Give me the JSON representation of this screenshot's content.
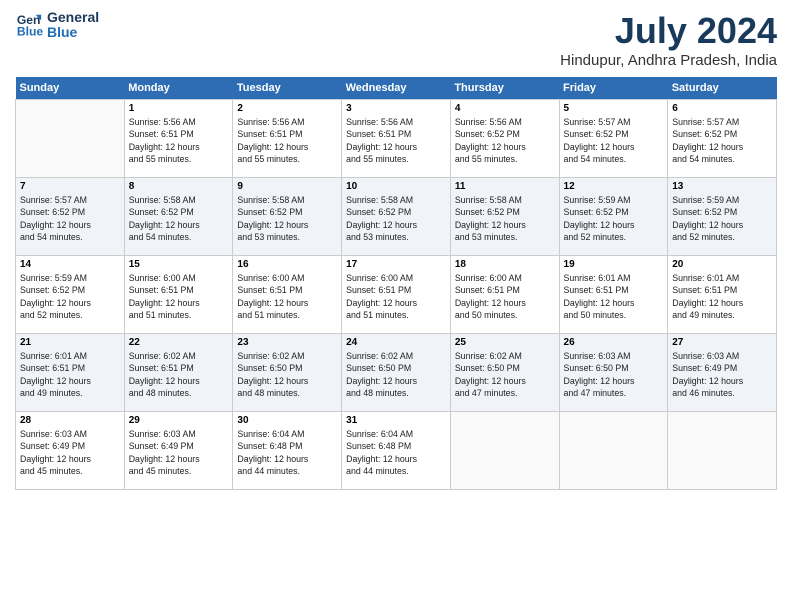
{
  "header": {
    "logo_line1": "General",
    "logo_line2": "Blue",
    "title": "July 2024",
    "subtitle": "Hindupur, Andhra Pradesh, India"
  },
  "calendar": {
    "days_of_week": [
      "Sunday",
      "Monday",
      "Tuesday",
      "Wednesday",
      "Thursday",
      "Friday",
      "Saturday"
    ],
    "weeks": [
      [
        {
          "num": "",
          "info": ""
        },
        {
          "num": "1",
          "info": "Sunrise: 5:56 AM\nSunset: 6:51 PM\nDaylight: 12 hours\nand 55 minutes."
        },
        {
          "num": "2",
          "info": "Sunrise: 5:56 AM\nSunset: 6:51 PM\nDaylight: 12 hours\nand 55 minutes."
        },
        {
          "num": "3",
          "info": "Sunrise: 5:56 AM\nSunset: 6:51 PM\nDaylight: 12 hours\nand 55 minutes."
        },
        {
          "num": "4",
          "info": "Sunrise: 5:56 AM\nSunset: 6:52 PM\nDaylight: 12 hours\nand 55 minutes."
        },
        {
          "num": "5",
          "info": "Sunrise: 5:57 AM\nSunset: 6:52 PM\nDaylight: 12 hours\nand 54 minutes."
        },
        {
          "num": "6",
          "info": "Sunrise: 5:57 AM\nSunset: 6:52 PM\nDaylight: 12 hours\nand 54 minutes."
        }
      ],
      [
        {
          "num": "7",
          "info": "Sunrise: 5:57 AM\nSunset: 6:52 PM\nDaylight: 12 hours\nand 54 minutes."
        },
        {
          "num": "8",
          "info": "Sunrise: 5:58 AM\nSunset: 6:52 PM\nDaylight: 12 hours\nand 54 minutes."
        },
        {
          "num": "9",
          "info": "Sunrise: 5:58 AM\nSunset: 6:52 PM\nDaylight: 12 hours\nand 53 minutes."
        },
        {
          "num": "10",
          "info": "Sunrise: 5:58 AM\nSunset: 6:52 PM\nDaylight: 12 hours\nand 53 minutes."
        },
        {
          "num": "11",
          "info": "Sunrise: 5:58 AM\nSunset: 6:52 PM\nDaylight: 12 hours\nand 53 minutes."
        },
        {
          "num": "12",
          "info": "Sunrise: 5:59 AM\nSunset: 6:52 PM\nDaylight: 12 hours\nand 52 minutes."
        },
        {
          "num": "13",
          "info": "Sunrise: 5:59 AM\nSunset: 6:52 PM\nDaylight: 12 hours\nand 52 minutes."
        }
      ],
      [
        {
          "num": "14",
          "info": "Sunrise: 5:59 AM\nSunset: 6:52 PM\nDaylight: 12 hours\nand 52 minutes."
        },
        {
          "num": "15",
          "info": "Sunrise: 6:00 AM\nSunset: 6:51 PM\nDaylight: 12 hours\nand 51 minutes."
        },
        {
          "num": "16",
          "info": "Sunrise: 6:00 AM\nSunset: 6:51 PM\nDaylight: 12 hours\nand 51 minutes."
        },
        {
          "num": "17",
          "info": "Sunrise: 6:00 AM\nSunset: 6:51 PM\nDaylight: 12 hours\nand 51 minutes."
        },
        {
          "num": "18",
          "info": "Sunrise: 6:00 AM\nSunset: 6:51 PM\nDaylight: 12 hours\nand 50 minutes."
        },
        {
          "num": "19",
          "info": "Sunrise: 6:01 AM\nSunset: 6:51 PM\nDaylight: 12 hours\nand 50 minutes."
        },
        {
          "num": "20",
          "info": "Sunrise: 6:01 AM\nSunset: 6:51 PM\nDaylight: 12 hours\nand 49 minutes."
        }
      ],
      [
        {
          "num": "21",
          "info": "Sunrise: 6:01 AM\nSunset: 6:51 PM\nDaylight: 12 hours\nand 49 minutes."
        },
        {
          "num": "22",
          "info": "Sunrise: 6:02 AM\nSunset: 6:51 PM\nDaylight: 12 hours\nand 48 minutes."
        },
        {
          "num": "23",
          "info": "Sunrise: 6:02 AM\nSunset: 6:50 PM\nDaylight: 12 hours\nand 48 minutes."
        },
        {
          "num": "24",
          "info": "Sunrise: 6:02 AM\nSunset: 6:50 PM\nDaylight: 12 hours\nand 48 minutes."
        },
        {
          "num": "25",
          "info": "Sunrise: 6:02 AM\nSunset: 6:50 PM\nDaylight: 12 hours\nand 47 minutes."
        },
        {
          "num": "26",
          "info": "Sunrise: 6:03 AM\nSunset: 6:50 PM\nDaylight: 12 hours\nand 47 minutes."
        },
        {
          "num": "27",
          "info": "Sunrise: 6:03 AM\nSunset: 6:49 PM\nDaylight: 12 hours\nand 46 minutes."
        }
      ],
      [
        {
          "num": "28",
          "info": "Sunrise: 6:03 AM\nSunset: 6:49 PM\nDaylight: 12 hours\nand 45 minutes."
        },
        {
          "num": "29",
          "info": "Sunrise: 6:03 AM\nSunset: 6:49 PM\nDaylight: 12 hours\nand 45 minutes."
        },
        {
          "num": "30",
          "info": "Sunrise: 6:04 AM\nSunset: 6:48 PM\nDaylight: 12 hours\nand 44 minutes."
        },
        {
          "num": "31",
          "info": "Sunrise: 6:04 AM\nSunset: 6:48 PM\nDaylight: 12 hours\nand 44 minutes."
        },
        {
          "num": "",
          "info": ""
        },
        {
          "num": "",
          "info": ""
        },
        {
          "num": "",
          "info": ""
        }
      ]
    ]
  }
}
